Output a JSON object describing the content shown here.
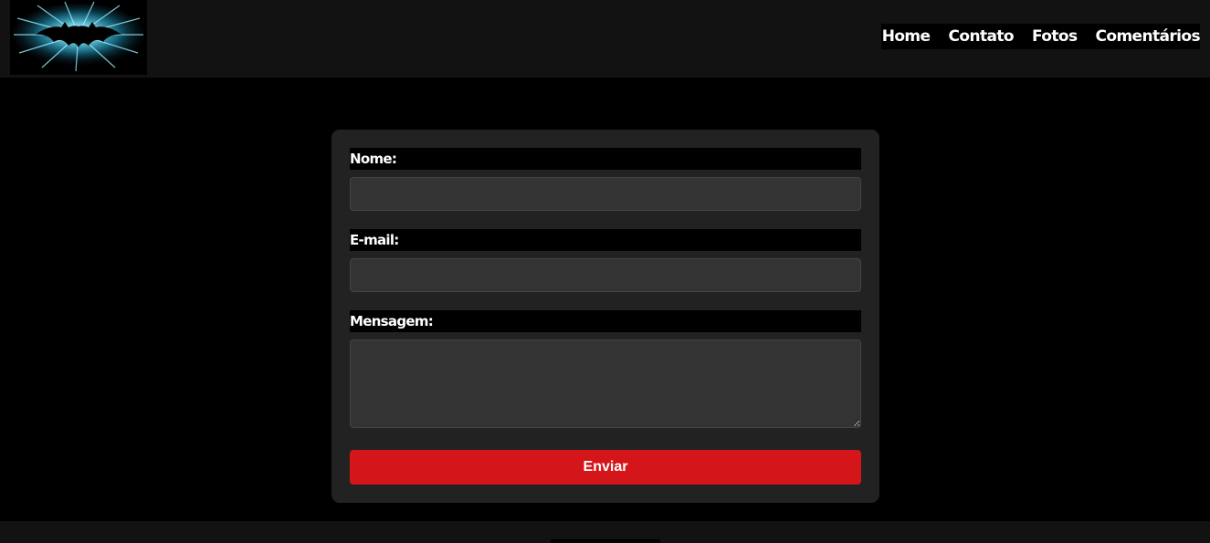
{
  "header": {
    "logo_icon": "batman-logo-icon",
    "nav": [
      {
        "label": "Home"
      },
      {
        "label": "Contato"
      },
      {
        "label": "Fotos"
      },
      {
        "label": "Comentários"
      }
    ]
  },
  "form": {
    "name_label": "Nome:",
    "name_value": "",
    "email_label": "E-mail:",
    "email_value": "",
    "message_label": "Mensagem:",
    "message_value": "",
    "submit_label": "Enviar"
  },
  "colors": {
    "page_background": "#000000",
    "header_background": "#121212",
    "card_background": "#222222",
    "input_background": "#333333",
    "button_color": "#d4161a",
    "logo_glow": "#39c6e6"
  }
}
